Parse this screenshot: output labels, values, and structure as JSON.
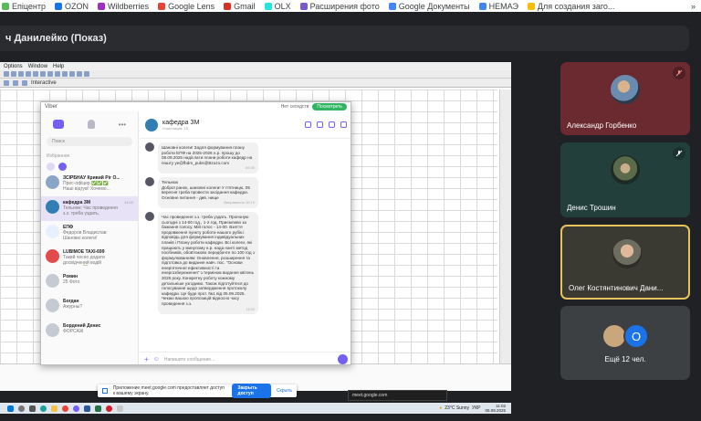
{
  "bookmarks": [
    {
      "label": "Епіцентр",
      "color": "#5cb85c"
    },
    {
      "label": "OZON",
      "color": "#1a73e8"
    },
    {
      "label": "Wildberries",
      "color": "#a02cc4"
    },
    {
      "label": "Google Lens",
      "color": "#ea4335"
    },
    {
      "label": "Gmail",
      "color": "#d93025"
    },
    {
      "label": "OLX",
      "color": "#23e5db"
    },
    {
      "label": "Расширения фото",
      "color": "#7a58d1"
    },
    {
      "label": "Google Документы",
      "color": "#4285f4"
    },
    {
      "label": "НЕМАЭ",
      "color": "#4285f4"
    },
    {
      "label": "Для создания заго...",
      "color": "#fbbc04"
    }
  ],
  "bookmarks_more": "»",
  "meeting_title": "ч Данилейко (Показ)",
  "shared_app": {
    "menu": [
      "Options",
      "Window",
      "Help"
    ],
    "toolbar_text": [
      "Interactive"
    ]
  },
  "viber": {
    "title": "Viber",
    "search_placeholder": "Поиск",
    "favorites_label": "Избранное",
    "topbar_status": "Нет сеседств",
    "topbar_button": "Посмотреть",
    "chats": [
      {
        "name": "ЗСІРБНАУ Кривий Ріг О...",
        "msg": "Прес-офіцер ✅✅✅ Наші відгукі! Хочемо...",
        "time": "",
        "color": "#8aa6c7"
      },
      {
        "name": "кафедра ЗМ",
        "msg": "Тельнюк: Час проведення з.з. треба уздать. Пропоную сьогод...",
        "time": "11:02",
        "color": "#2f7fb5",
        "active": true
      },
      {
        "name": "ЕПФ",
        "msg": "Федоров Владислав: Шановні колеги!",
        "time": "",
        "color": "#e8f0ff"
      },
      {
        "name": "LUBIMOE TAXI-699",
        "msg": "Такий чесно додати досвідчений водій сачмати! ✅ФОРСАЖ",
        "time": "",
        "color": "#e14b4b"
      },
      {
        "name": "Ромин",
        "msg": "25 Фото",
        "time": "",
        "color": "#c5cad3"
      },
      {
        "name": "Богдан",
        "msg": "Ажурны?",
        "time": "",
        "color": "#c5cad3"
      },
      {
        "name": "Бордений Денис",
        "msg": "ФОРСАЖ",
        "time": "",
        "color": "#c5cad3"
      }
    ],
    "chat_header": {
      "name": "кафедра ЗМ",
      "sub": "Участников: 15"
    },
    "messages": [
      {
        "text": "Шановні колеги! Задля формування плану роботи ЕПФ на 2025-2026 н.р. прошу до 08.09.2025 надіслати плани роботи кафедр на пошту ye@fbdm_pubs@Bzuzo.com",
        "meta": "09:45"
      },
      {
        "text": "Тельнюк\nДоброї ранок, шановні колеги! У п'ятницю, 05 вересня треба провести засідання кафедри. Основне питання - див. нище",
        "meta": "Виправлено 10:19"
      },
      {
        "text": "Час проведення з.з. треба уздать. Пропоную сьогодні з 14-00 год., 1-2 год. Приємливо за бажання голосу. Мій голос - 14-00. Взяття продовження пункту роботи нашого рубік.і відповідь для формування індивідуальних планів і Плану роботи кафедри. Всі колеги, які працюють у минулому н.р. нада нанті метод посібників, обов'язково передбачте по 100 год з формулюванням: Оновлення, розширення та підготовка до видання навч. пос. \"Основи енергетичної ефективності та енергозбереження\" з терміном видання квітень 2026 року. Конкретну роботу кожному детальніше узгодимо. Також підготуйтеся до голосування щодо затвердження протоколу кафедри. Це буде прот. №1 від 05.09.2025. Чекаю вашою пропозицій відносно часу проведення з.з.",
        "meta": "11:02"
      }
    ],
    "input_placeholder": "Напишите сообщение..."
  },
  "share_bar": {
    "text": "Приложение meet.google.com предоставляет доступ к вашему экрану.",
    "stop": "Закрыть доступ",
    "hide": "Скрыть"
  },
  "meet_popup": "meet.google.com",
  "taskbar": {
    "weather": "23°C Sunny",
    "lang": "УКР",
    "time": "11:02",
    "date": "05.09.2025"
  },
  "participants": [
    {
      "name": "Александр Горбенко",
      "muted": true
    },
    {
      "name": "Денис Трошин",
      "muted": true
    },
    {
      "name": "Олег Костянтинович Дани...",
      "muted": false
    },
    {
      "name": "Ещё 12 чел.",
      "avatar_letter": "О"
    }
  ],
  "colors": {
    "meet_bg": "#202124",
    "mute_red": "#ea4335",
    "accent_blue": "#1a73e8",
    "viber_purple": "#7360f2",
    "speaking_border": "#e8c25a"
  }
}
